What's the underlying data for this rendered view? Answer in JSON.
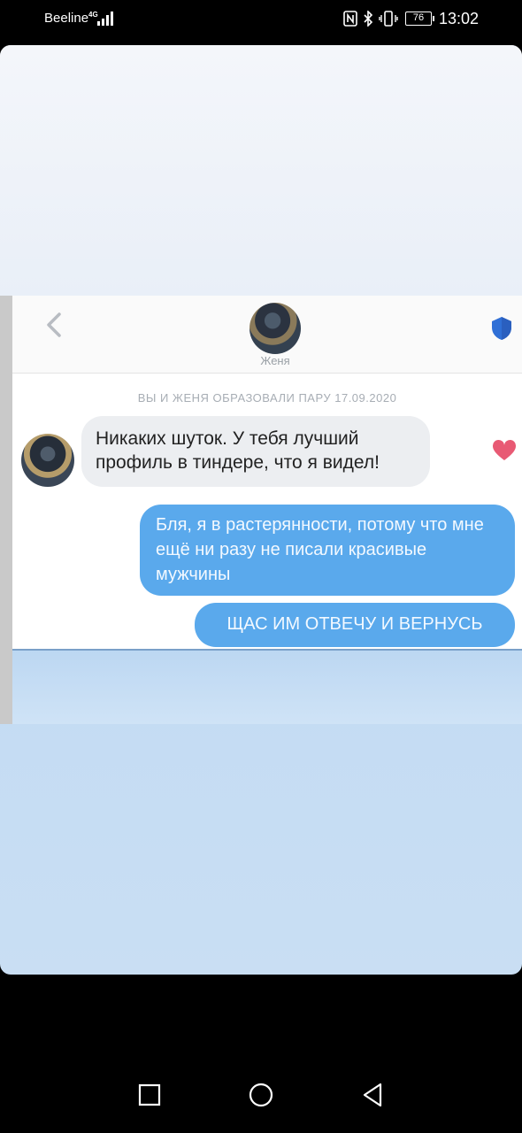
{
  "status_bar": {
    "carrier": "Beeline",
    "network": "4G",
    "battery": "76",
    "time": "13:02"
  },
  "chat": {
    "contact_name": "Женя",
    "match_notice": "ВЫ И ЖЕНЯ ОБРАЗОВАЛИ ПАРУ 17.09.2020",
    "messages": [
      {
        "from": "them",
        "text": "Никаких шуток. У тебя лучший профиль в тиндере, что я видел!"
      },
      {
        "from": "me",
        "text": "Бля, я в растерянности, потому что мне ещё ни разу не писали красивые мужчины"
      },
      {
        "from": "me",
        "text": "ЩАС ИМ ОТВЕЧУ И ВЕРНУСЬ"
      }
    ],
    "colors": {
      "outgoing_bubble": "#5aa9ec",
      "incoming_bubble": "#eceef1",
      "heart": "#e85a74",
      "shield": "#2f6fd6"
    }
  },
  "icons": {
    "back": "chevron-left-icon",
    "shield": "shield-icon",
    "heart": "heart-icon",
    "nav_recents": "square-icon",
    "nav_home": "circle-icon",
    "nav_back": "triangle-back-icon"
  }
}
